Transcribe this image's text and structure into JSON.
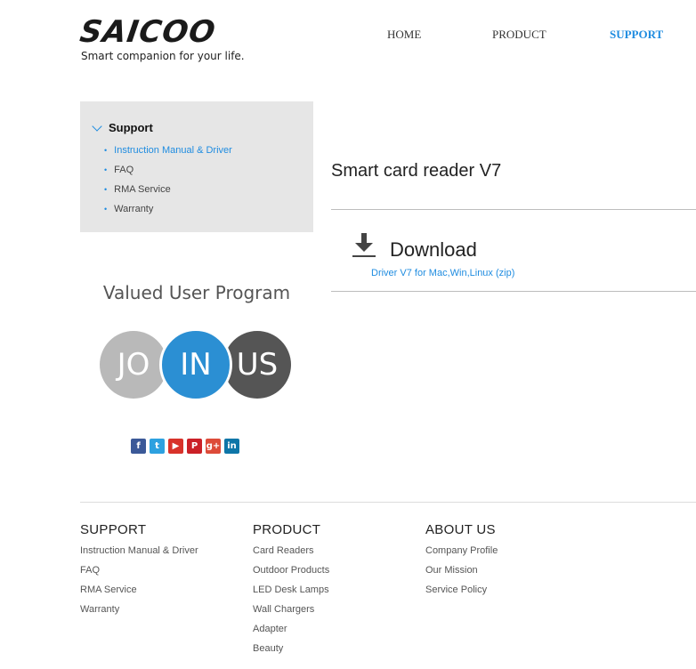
{
  "header": {
    "logo_text": "SAICOO",
    "tagline": "Smart companion for your life.",
    "nav": [
      {
        "label": "HOME",
        "active": false
      },
      {
        "label": "PRODUCT",
        "active": false
      },
      {
        "label": "SUPPORT",
        "active": true
      }
    ]
  },
  "sidebar": {
    "heading": "Support",
    "items": [
      {
        "label": "Instruction Manual & Driver",
        "active": true
      },
      {
        "label": "FAQ",
        "active": false
      },
      {
        "label": "RMA Service",
        "active": false
      },
      {
        "label": "Warranty",
        "active": false
      }
    ]
  },
  "promo": {
    "title": "Valued User Program",
    "join_parts": [
      "JO",
      "IN",
      "US"
    ]
  },
  "social": [
    {
      "icon": "facebook-icon",
      "glyph": "f",
      "color": "#3b5998"
    },
    {
      "icon": "twitter-icon",
      "glyph": "t",
      "color": "#2da1e0"
    },
    {
      "icon": "youtube-icon",
      "glyph": "▶",
      "color": "#d8322a"
    },
    {
      "icon": "pinterest-icon",
      "glyph": "P",
      "color": "#cb2027"
    },
    {
      "icon": "googleplus-icon",
      "glyph": "g+",
      "color": "#dd4b39"
    },
    {
      "icon": "linkedin-icon",
      "glyph": "in",
      "color": "#0e76a8"
    }
  ],
  "main": {
    "product_title": "Smart card reader V7",
    "download_heading": "Download",
    "download_link": "Driver V7 for Mac,Win,Linux (zip)"
  },
  "footer": {
    "support": {
      "heading": "SUPPORT",
      "items": [
        "Instruction Manual & Driver",
        "FAQ",
        "RMA Service",
        "Warranty"
      ]
    },
    "product": {
      "heading": "PRODUCT",
      "items": [
        "Card Readers",
        "Outdoor Products",
        "LED Desk Lamps",
        "Wall Chargers",
        "Adapter",
        "Beauty"
      ]
    },
    "about": {
      "heading": "ABOUT US",
      "items": [
        "Company Profile",
        "Our Mission",
        "Service Policy"
      ]
    }
  },
  "colors": {
    "accent": "#1f8ce0",
    "sidebar_bg": "#e6e6e6"
  }
}
